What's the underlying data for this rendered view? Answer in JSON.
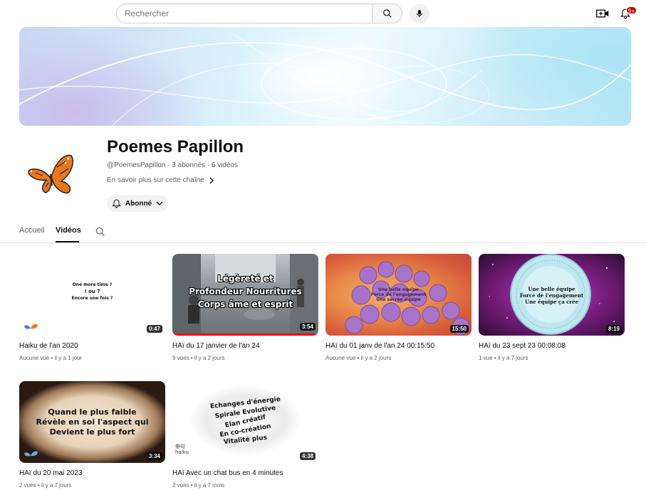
{
  "search": {
    "placeholder": "Rechercher"
  },
  "header": {
    "notification_count": "9+"
  },
  "colors": {
    "accent": "#cc0000",
    "progress": "#ff0000",
    "text_secondary": "#606060"
  },
  "channel": {
    "name": "Poemes Papillon",
    "meta": "@PoemesPapillon · 3 abonnés · 6 vidéos",
    "more_label": "En savoir plus sur cette chaîne",
    "subscribe_label": "Abonné"
  },
  "tabs": [
    {
      "label": "Accueil",
      "active": false
    },
    {
      "label": "Vidéos",
      "active": true
    }
  ],
  "videos": [
    {
      "title": "Haiku de l'an 2020",
      "meta": "Aucune vue • il y a 1 jour",
      "duration": "0:47",
      "thumb_text": [
        "One more time ?",
        "! ou ?",
        "Encore une fois ?"
      ]
    },
    {
      "title": "HAï du 17 janvier de l'an 24",
      "meta": "9 vues • il y a 2 jours",
      "duration": "3:54",
      "watched_fraction": 1.0,
      "thumb_text": [
        "Légèreté et",
        "Profondeur Nourritures",
        "Corps âme et esprit"
      ]
    },
    {
      "title": "HAï du 01 janv de l'an 24 00:15:50",
      "meta": "Aucune vue • il y a 2 jours",
      "duration": "15:50",
      "thumb_text": [
        "Une belle équipe",
        "Force de l'engagement",
        "Une sacrée équipe"
      ]
    },
    {
      "title": "HAï du 23 sept 23 00:08:08",
      "meta": "1 vue • il y a 7 jours",
      "duration": "8:19",
      "thumb_text": [
        "Une belle équipe",
        "Force de l'engagement",
        "Une équipe ça crée"
      ]
    },
    {
      "title": "HAï du 20 mai 2023",
      "meta": "2 vues • il y a 7 jours",
      "duration": "3:34",
      "thumb_text": [
        "Quand le plus faible",
        "Révèle en soi l'aspect qui",
        "Devient le plus fort"
      ]
    },
    {
      "title": "HAï Avec un chat bus en 4 minutes",
      "meta": "2 vues • il y a 7 mois",
      "duration": "4:38",
      "thumb_text": [
        "Echanges d'énergie",
        "Spirale Evolutive",
        "Elan créatif",
        "En co-création",
        "Vitalité plus"
      ],
      "thumb_logo": [
        "俳句",
        "haiku"
      ]
    }
  ]
}
